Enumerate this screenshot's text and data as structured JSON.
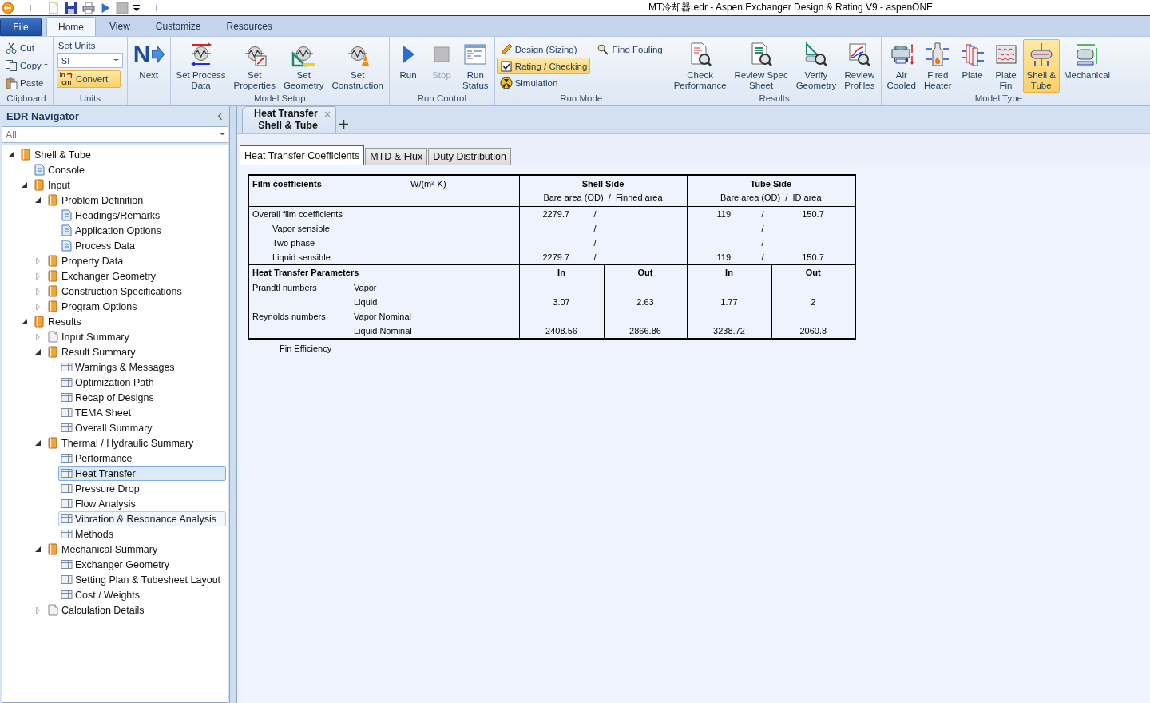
{
  "title_bar": {
    "title": "MT冷却器.edr - Aspen Exchanger Design & Rating V9 - aspenONE"
  },
  "ribbon_tabs": [
    {
      "label": "File",
      "kind": "file",
      "selected": false
    },
    {
      "label": "Home",
      "kind": "tab",
      "selected": true
    },
    {
      "label": "View",
      "kind": "tab",
      "selected": false
    },
    {
      "label": "Customize",
      "kind": "tab",
      "selected": false
    },
    {
      "label": "Resources",
      "kind": "tab",
      "selected": false
    }
  ],
  "ribbon": {
    "groups": [
      {
        "label": "Clipboard",
        "items": [
          {
            "kind": "small",
            "label": "Cut"
          },
          {
            "kind": "split",
            "label": "Copy"
          },
          {
            "kind": "small",
            "label": "Paste"
          }
        ]
      },
      {
        "label": "Units",
        "items": [
          {
            "kind": "caption",
            "label": "Set Units"
          },
          {
            "kind": "select",
            "value": "SI"
          },
          {
            "kind": "small",
            "label": "Convert",
            "icon_text": [
              "in",
              "cm"
            ],
            "highlighted": true
          }
        ]
      },
      {
        "items": [
          {
            "kind": "large",
            "label": "Next",
            "icon_text": "N"
          }
        ]
      },
      {
        "label": "Model Setup",
        "items": [
          {
            "kind": "large",
            "label": "Set Process\nData"
          },
          {
            "kind": "large",
            "label": "Set\nProperties"
          },
          {
            "kind": "large",
            "label": "Set\nGeometry"
          },
          {
            "kind": "large",
            "label": "Set\nConstruction"
          }
        ]
      },
      {
        "label": "Run Control",
        "items": [
          {
            "kind": "large",
            "label": "Run",
            "disabled": false
          },
          {
            "kind": "large",
            "label": "Stop",
            "disabled": true
          },
          {
            "kind": "large",
            "label": "Run\nStatus",
            "disabled": false
          }
        ]
      },
      {
        "label": "Run Mode",
        "items": [
          {
            "kind": "small",
            "label": "Design (Sizing)",
            "selected": false
          },
          {
            "kind": "small",
            "label": "Rating / Checking",
            "selected": true
          },
          {
            "kind": "small",
            "label": "Simulation",
            "selected": false
          },
          {
            "kind": "small",
            "label": "Find Fouling",
            "selected": false
          }
        ]
      },
      {
        "label": "Results",
        "items": [
          {
            "kind": "large",
            "label": "Check\nPerformance"
          },
          {
            "kind": "large",
            "label": "Review Spec\nSheet"
          },
          {
            "kind": "large",
            "label": "Verify\nGeometry"
          },
          {
            "kind": "large",
            "label": "Review\nProfiles"
          }
        ]
      },
      {
        "label": "Model Type",
        "items": [
          {
            "kind": "large",
            "label": "Air\nCooled",
            "selected": false
          },
          {
            "kind": "large",
            "label": "Fired\nHeater",
            "selected": false
          },
          {
            "kind": "large",
            "label": "Plate",
            "selected": false
          },
          {
            "kind": "large",
            "label": "Plate\nFin",
            "selected": false
          },
          {
            "kind": "large",
            "label": "Shell &\nTube",
            "selected": true
          },
          {
            "kind": "large",
            "label": "Mechanical",
            "selected": false
          }
        ]
      }
    ]
  },
  "navigator": {
    "title": "EDR Navigator",
    "filter": "All",
    "tree": [
      {
        "label": "Shell & Tube",
        "kind": "section",
        "expanded": true,
        "selected": false,
        "hovered": false,
        "children": [
          {
            "label": "Console",
            "kind": "form",
            "selected": false,
            "hovered": false
          },
          {
            "label": "Input",
            "kind": "section",
            "expanded": true,
            "selected": false,
            "hovered": false,
            "children": [
              {
                "label": "Problem Definition",
                "kind": "section",
                "expanded": true,
                "selected": false,
                "hovered": false,
                "children": [
                  {
                    "label": "Headings/Remarks",
                    "kind": "form",
                    "selected": false,
                    "hovered": false
                  },
                  {
                    "label": "Application Options",
                    "kind": "form",
                    "selected": false,
                    "hovered": false
                  },
                  {
                    "label": "Process Data",
                    "kind": "form",
                    "selected": false,
                    "hovered": false
                  }
                ]
              },
              {
                "label": "Property Data",
                "kind": "section",
                "expanded": false,
                "selected": false,
                "hovered": false
              },
              {
                "label": "Exchanger Geometry",
                "kind": "section",
                "expanded": false,
                "selected": false,
                "hovered": false
              },
              {
                "label": "Construction Specifications",
                "kind": "section",
                "expanded": false,
                "selected": false,
                "hovered": false
              },
              {
                "label": "Program Options",
                "kind": "section",
                "expanded": false,
                "selected": false,
                "hovered": false
              }
            ]
          },
          {
            "label": "Results",
            "kind": "section",
            "expanded": true,
            "selected": false,
            "hovered": false,
            "children": [
              {
                "label": "Input Summary",
                "kind": "report",
                "expanded": false,
                "selected": false,
                "hovered": false
              },
              {
                "label": "Result Summary",
                "kind": "section",
                "expanded": true,
                "selected": false,
                "hovered": false,
                "children": [
                  {
                    "label": "Warnings & Messages",
                    "kind": "sheet",
                    "selected": false,
                    "hovered": false
                  },
                  {
                    "label": "Optimization Path",
                    "kind": "sheet",
                    "selected": false,
                    "hovered": false
                  },
                  {
                    "label": "Recap of Designs",
                    "kind": "sheet",
                    "selected": false,
                    "hovered": false
                  },
                  {
                    "label": "TEMA Sheet",
                    "kind": "sheet",
                    "selected": false,
                    "hovered": false
                  },
                  {
                    "label": "Overall Summary",
                    "kind": "sheet",
                    "selected": false,
                    "hovered": false
                  }
                ]
              },
              {
                "label": "Thermal / Hydraulic Summary",
                "kind": "section",
                "expanded": true,
                "selected": false,
                "hovered": false,
                "children": [
                  {
                    "label": "Performance",
                    "kind": "sheet",
                    "selected": false,
                    "hovered": false
                  },
                  {
                    "label": "Heat Transfer",
                    "kind": "sheet",
                    "selected": true,
                    "hovered": false
                  },
                  {
                    "label": "Pressure Drop",
                    "kind": "sheet",
                    "selected": false,
                    "hovered": false
                  },
                  {
                    "label": "Flow Analysis",
                    "kind": "sheet",
                    "selected": false,
                    "hovered": false
                  },
                  {
                    "label": "Vibration & Resonance Analysis",
                    "kind": "sheet",
                    "selected": false,
                    "hovered": true
                  },
                  {
                    "label": "Methods",
                    "kind": "sheet",
                    "selected": false,
                    "hovered": false
                  }
                ]
              },
              {
                "label": "Mechanical Summary",
                "kind": "section",
                "expanded": true,
                "selected": false,
                "hovered": false,
                "children": [
                  {
                    "label": "Exchanger Geometry",
                    "kind": "sheet",
                    "selected": false,
                    "hovered": false
                  },
                  {
                    "label": "Setting Plan & Tubesheet Layout",
                    "kind": "sheet",
                    "selected": false,
                    "hovered": false
                  },
                  {
                    "label": "Cost / Weights",
                    "kind": "sheet",
                    "selected": false,
                    "hovered": false
                  }
                ]
              },
              {
                "label": "Calculation Details",
                "kind": "report",
                "expanded": false,
                "selected": false,
                "hovered": false
              }
            ]
          }
        ]
      }
    ]
  },
  "document": {
    "tab": {
      "title": "Heat Transfer",
      "subtitle": "Shell & Tube"
    },
    "sheet_tabs": [
      {
        "label": "Heat Transfer Coefficients",
        "selected": true
      },
      {
        "label": "MTD & Flux",
        "selected": false
      },
      {
        "label": "Duty Distribution",
        "selected": false
      }
    ],
    "film_coefficients": {
      "heading": "Film coefficients",
      "unit": "W/(m²-K)",
      "shell": {
        "heading": "Shell Side",
        "subheading": "Bare area (OD)  /  Finned area"
      },
      "tube": {
        "heading": "Tube Side",
        "subheading": "Bare area (OD)  /  ID area"
      },
      "rows": [
        {
          "label": "Overall film coefficients",
          "shell_bare": "2279.7",
          "shell_sep": "/",
          "tube_bare": "119",
          "tube_sep": "/",
          "tube_id": "150.7",
          "children": [
            {
              "label": "Vapor sensible",
              "shell_sep": "/",
              "tube_sep": "/"
            },
            {
              "label": "Two phase",
              "shell_sep": "/",
              "tube_sep": "/"
            },
            {
              "label": "Liquid sensible",
              "shell_bare": "2279.7",
              "shell_sep": "/",
              "tube_bare": "119",
              "tube_sep": "/",
              "tube_id": "150.7"
            }
          ]
        }
      ]
    },
    "parameters": {
      "heading": "Heat Transfer Parameters",
      "columns": [
        "In",
        "Out",
        "In",
        "Out"
      ],
      "rows": [
        {
          "label": "Prandtl numbers",
          "children": [
            {
              "label": "Vapor"
            },
            {
              "label": "Liquid",
              "values": [
                "3.07",
                "2.63",
                "1.77",
                "2"
              ]
            }
          ]
        },
        {
          "label": "Reynolds numbers",
          "children": [
            {
              "label": "Vapor Nominal"
            },
            {
              "label": "Liquid Nominal",
              "values": [
                "2408.56",
                "2866.86",
                "3238.72",
                "2060.8"
              ]
            }
          ]
        }
      ]
    },
    "note": "Fin Efficiency"
  }
}
